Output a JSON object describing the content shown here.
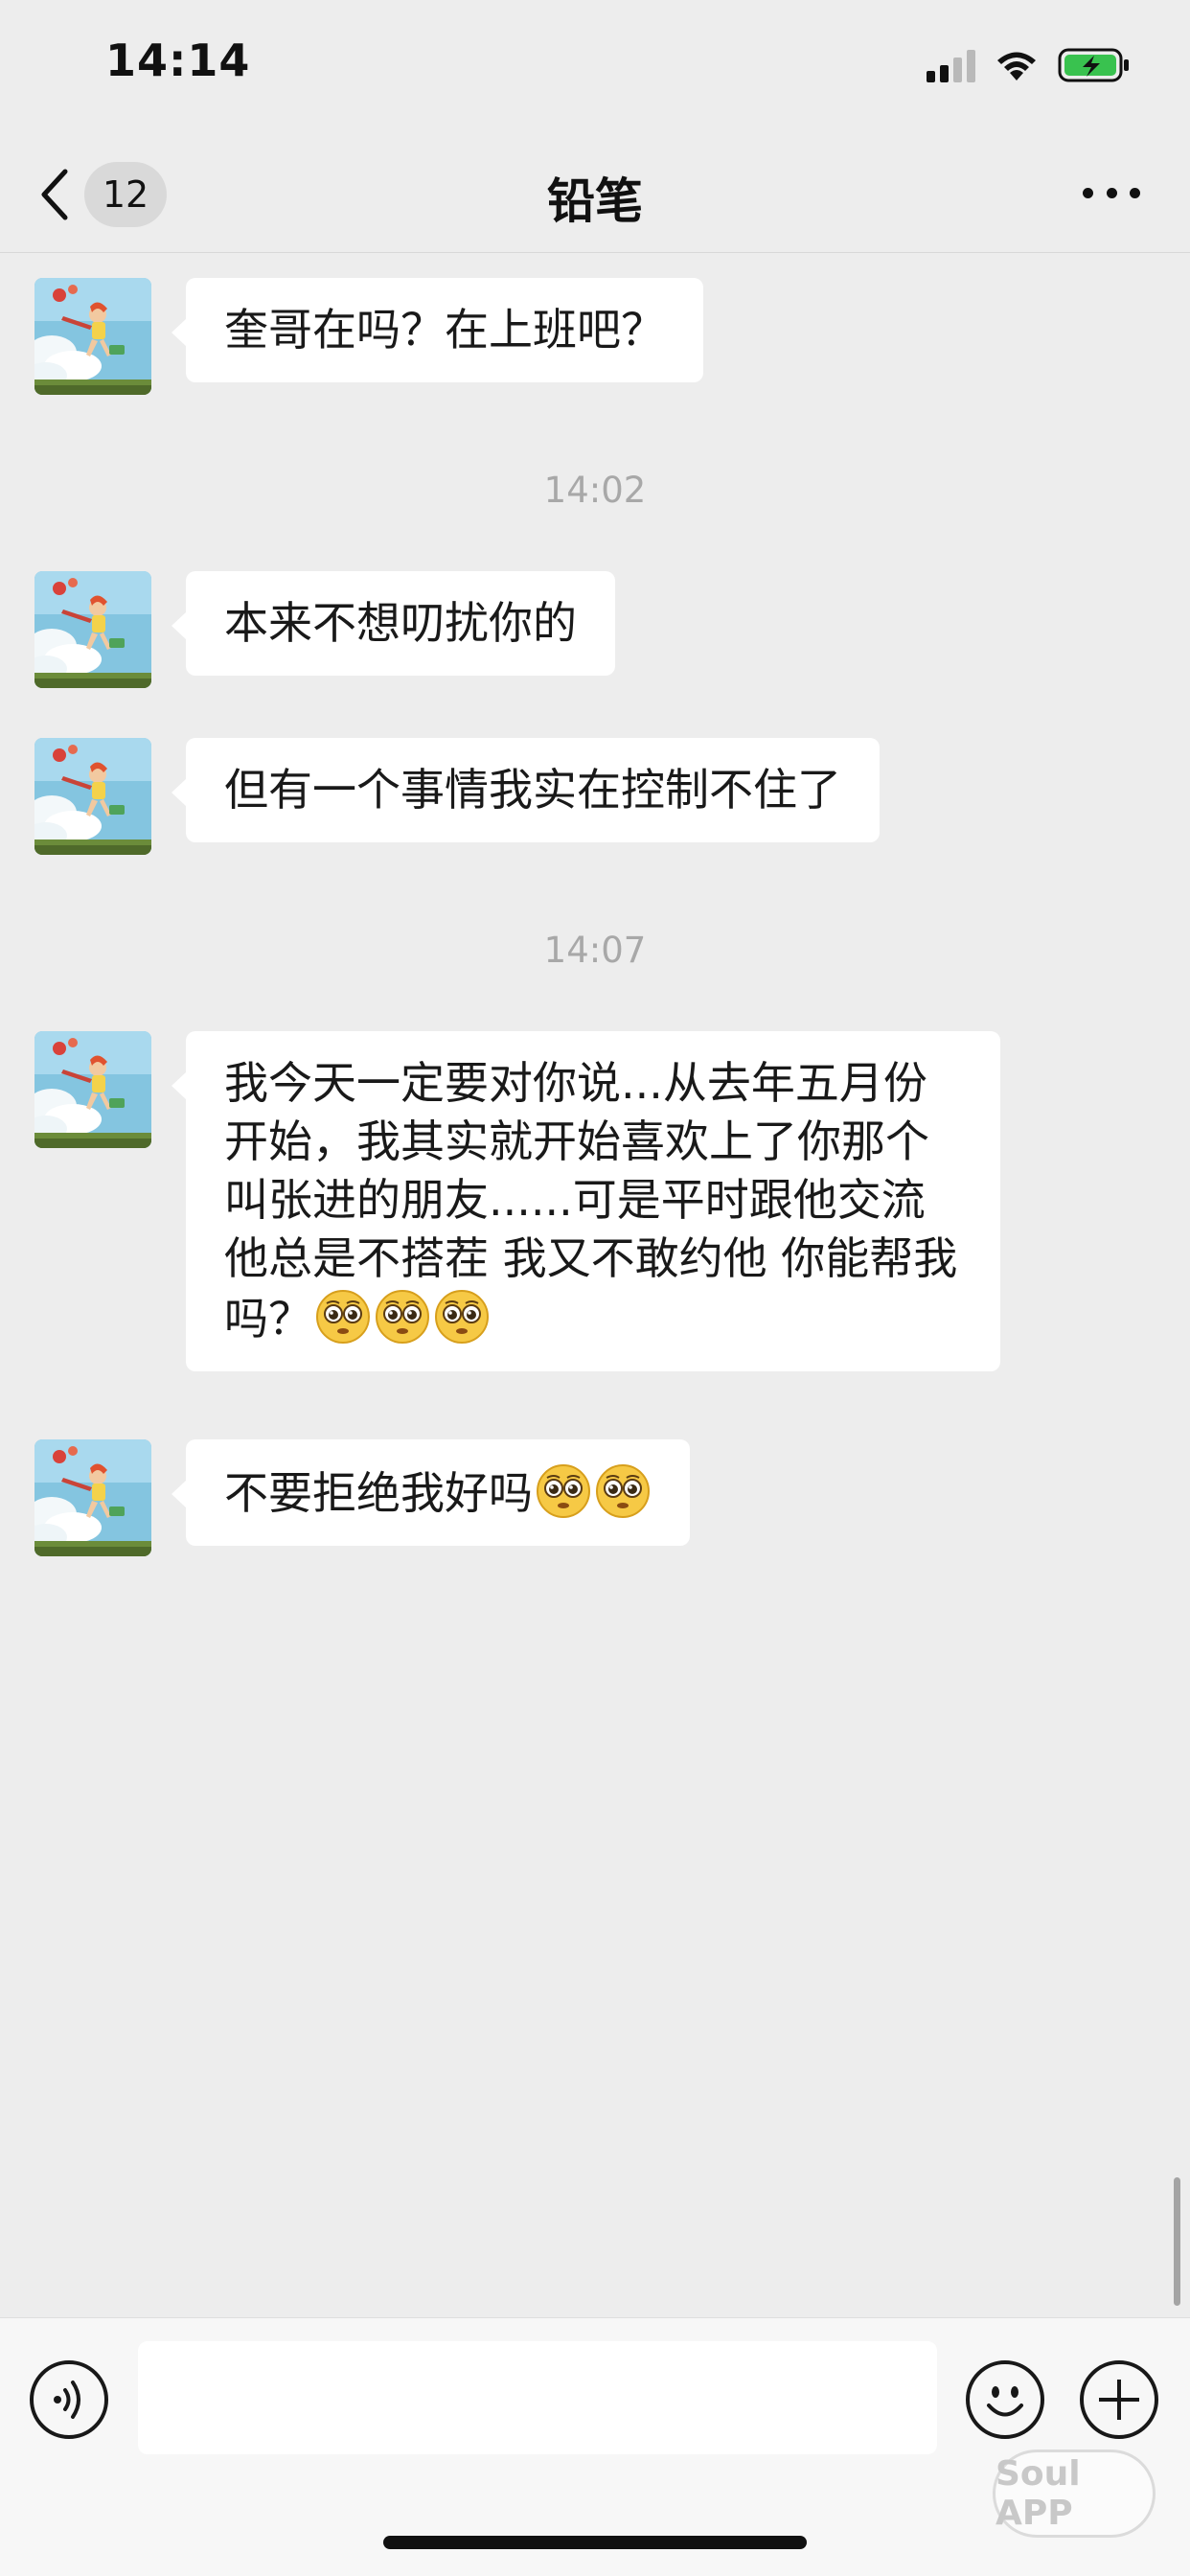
{
  "status_bar": {
    "time": "14:14"
  },
  "nav": {
    "back_badge": "12",
    "title": "铅笔"
  },
  "messages": [
    {
      "type": "message",
      "text": "奎哥在吗？在上班吧？"
    },
    {
      "type": "time",
      "text": "14:02"
    },
    {
      "type": "message",
      "text": "本来不想叨扰你的"
    },
    {
      "type": "message",
      "text": "但有一个事情我实在控制不住了"
    },
    {
      "type": "time",
      "text": "14:07"
    },
    {
      "type": "message",
      "text": "我今天一定要对你说...从去年五月份开始，我其实就开始喜欢上了你那个叫张进的朋友......可是平时跟他交流他总是不搭茬 我又不敢约他 你能帮我吗？",
      "emoji": [
        "pleading-face",
        "pleading-face",
        "pleading-face"
      ]
    },
    {
      "type": "message",
      "text": "不要拒绝我好吗",
      "emoji": [
        "pleading-face",
        "pleading-face"
      ]
    }
  ],
  "input": {
    "value": ""
  },
  "watermark": "Soul APP",
  "colors": {
    "background": "#ededed",
    "bubble": "#ffffff",
    "time_text": "#a8a8a8"
  }
}
